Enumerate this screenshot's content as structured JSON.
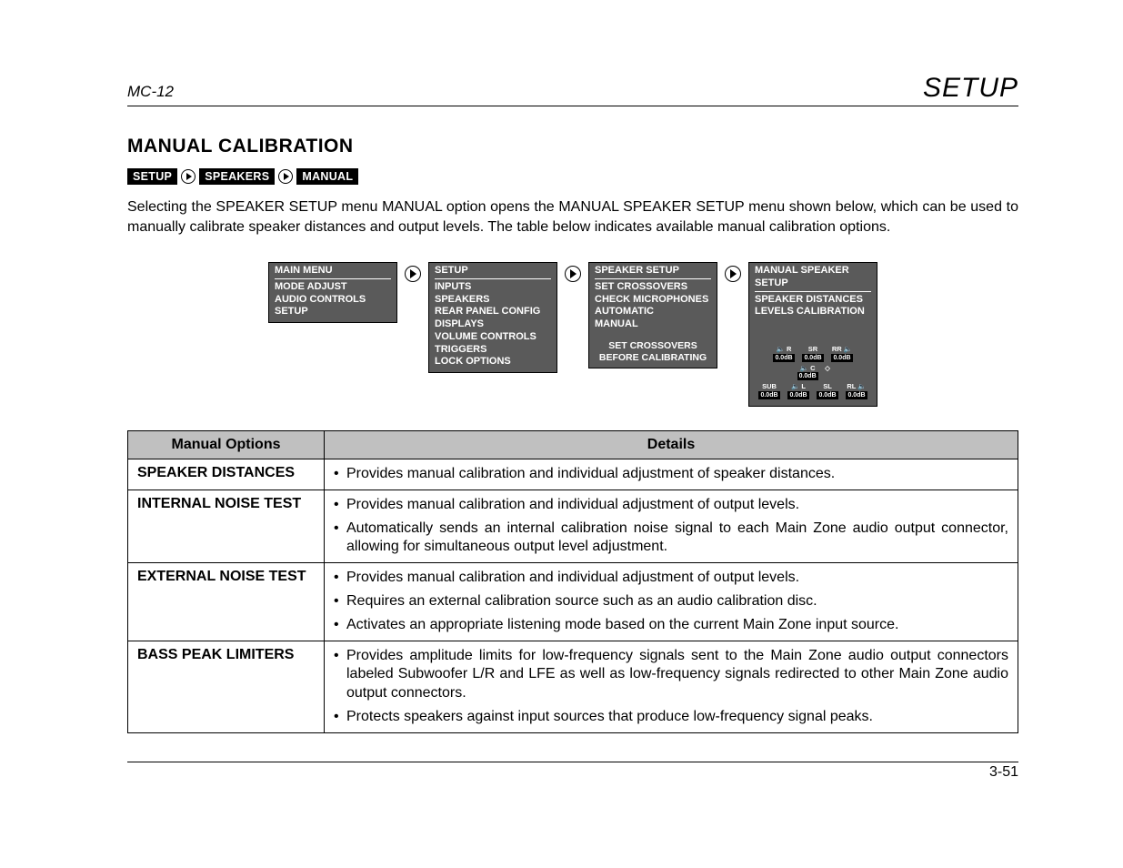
{
  "header": {
    "model": "MC-12",
    "section": "SETUP"
  },
  "title": "MANUAL CALIBRATION",
  "breadcrumb": [
    "SETUP",
    "SPEAKERS",
    "MANUAL"
  ],
  "intro": "Selecting the SPEAKER SETUP menu MANUAL option opens the MANUAL SPEAKER SETUP menu shown below, which can be used to manually calibrate speaker distances and output levels. The table below indicates available manual calibration options.",
  "menus": [
    {
      "title": "MAIN MENU",
      "items": [
        "MODE ADJUST",
        "AUDIO CONTROLS",
        "SETUP"
      ]
    },
    {
      "title": "SETUP",
      "items": [
        "INPUTS",
        "SPEAKERS",
        "REAR PANEL CONFIG",
        "DISPLAYS",
        "VOLUME CONTROLS",
        "TRIGGERS",
        "LOCK OPTIONS"
      ]
    },
    {
      "title": "SPEAKER SETUP",
      "items": [
        "SET CROSSOVERS",
        "CHECK MICROPHONES",
        "AUTOMATIC",
        "MANUAL"
      ],
      "note1": "SET CROSSOVERS",
      "note2": "BEFORE CALIBRATING"
    },
    {
      "title": "MANUAL SPEAKER SETUP",
      "items": [
        "SPEAKER DISTANCES",
        "LEVELS CALIBRATION"
      ],
      "speakers": {
        "row1": [
          {
            "label": "R",
            "db": "0.0dB"
          },
          {
            "label": "SR",
            "db": "0.0dB"
          },
          {
            "label": "RR",
            "db": "0.0dB"
          }
        ],
        "row2": [
          {
            "label": "C",
            "db": "0.0dB"
          }
        ],
        "row3": [
          {
            "label": "SUB",
            "db": "0.0dB"
          },
          {
            "label": "L",
            "db": "0.0dB"
          },
          {
            "label": "SL",
            "db": "0.0dB"
          },
          {
            "label": "RL",
            "db": "0.0dB"
          }
        ]
      }
    }
  ],
  "table": {
    "headers": [
      "Manual Options",
      "Details"
    ],
    "rows": [
      {
        "option": "SPEAKER DISTANCES",
        "details": [
          "Provides manual calibration and individual adjustment of speaker distances."
        ]
      },
      {
        "option": "INTERNAL NOISE TEST",
        "details": [
          "Provides manual calibration and individual adjustment of output levels.",
          "Automatically sends an internal calibration noise signal to each Main Zone audio output connector, allowing for simultaneous output level adjustment."
        ]
      },
      {
        "option": "EXTERNAL NOISE TEST",
        "details": [
          "Provides manual calibration and individual adjustment of output levels.",
          "Requires an external calibration source such as an audio calibration disc.",
          "Activates an appropriate listening mode based on the current Main Zone input source."
        ]
      },
      {
        "option": "BASS PEAK LIMITERS",
        "details": [
          "Provides amplitude limits for low-frequency signals sent to the Main Zone audio output connectors labeled Subwoofer L/R and LFE as well as low-frequency signals redirected to other Main Zone audio output connectors.",
          "Protects speakers against input sources that produce low-frequency signal peaks."
        ]
      }
    ]
  },
  "page_number": "3-51"
}
